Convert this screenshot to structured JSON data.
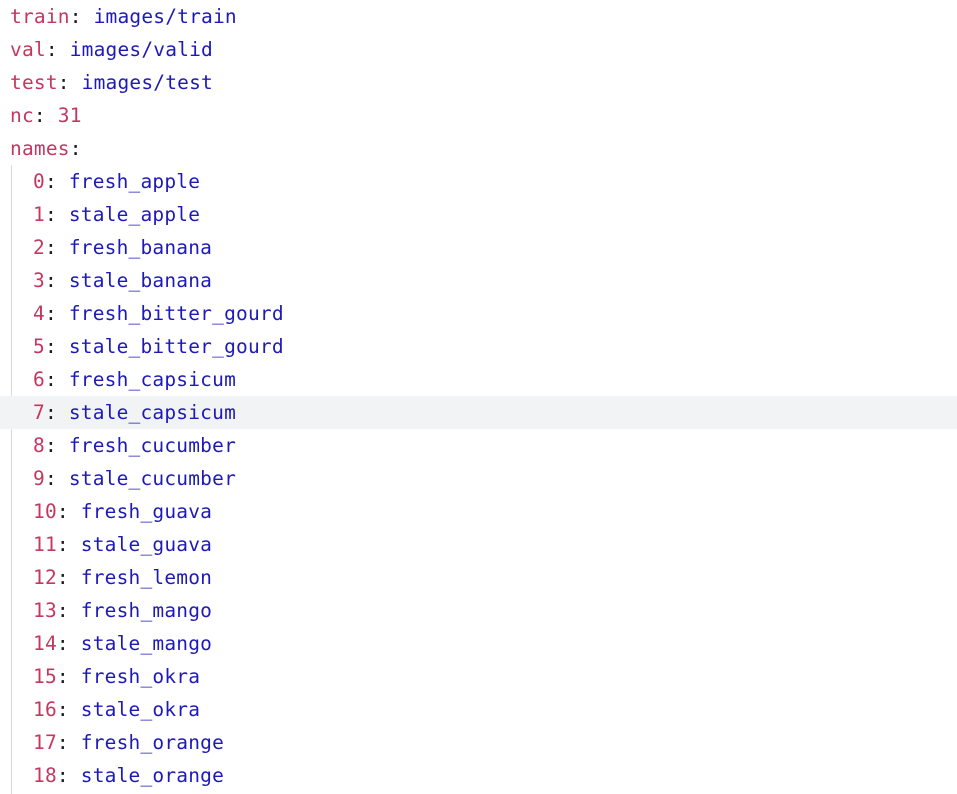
{
  "config": {
    "train": {
      "key": "train",
      "value": "images/train"
    },
    "val": {
      "key": "val",
      "value": "images/valid"
    },
    "test": {
      "key": "test",
      "value": "images/test"
    },
    "nc": {
      "key": "nc",
      "value": "31"
    },
    "names_key": "names"
  },
  "names": [
    {
      "index": "0",
      "name": "fresh_apple"
    },
    {
      "index": "1",
      "name": "stale_apple"
    },
    {
      "index": "2",
      "name": "fresh_banana"
    },
    {
      "index": "3",
      "name": "stale_banana"
    },
    {
      "index": "4",
      "name": "fresh_bitter_gourd"
    },
    {
      "index": "5",
      "name": "stale_bitter_gourd"
    },
    {
      "index": "6",
      "name": "fresh_capsicum"
    },
    {
      "index": "7",
      "name": "stale_capsicum"
    },
    {
      "index": "8",
      "name": "fresh_cucumber"
    },
    {
      "index": "9",
      "name": "stale_cucumber"
    },
    {
      "index": "10",
      "name": "fresh_guava"
    },
    {
      "index": "11",
      "name": "stale_guava"
    },
    {
      "index": "12",
      "name": "fresh_lemon"
    },
    {
      "index": "13",
      "name": "fresh_mango"
    },
    {
      "index": "14",
      "name": "stale_mango"
    },
    {
      "index": "15",
      "name": "fresh_okra"
    },
    {
      "index": "16",
      "name": "stale_okra"
    },
    {
      "index": "17",
      "name": "fresh_orange"
    },
    {
      "index": "18",
      "name": "stale_orange"
    }
  ],
  "colors": {
    "key": "#c4375f",
    "value": "#1d1ab8",
    "punctuation": "#1a1a1a",
    "current_line": "#f2f3f5"
  }
}
